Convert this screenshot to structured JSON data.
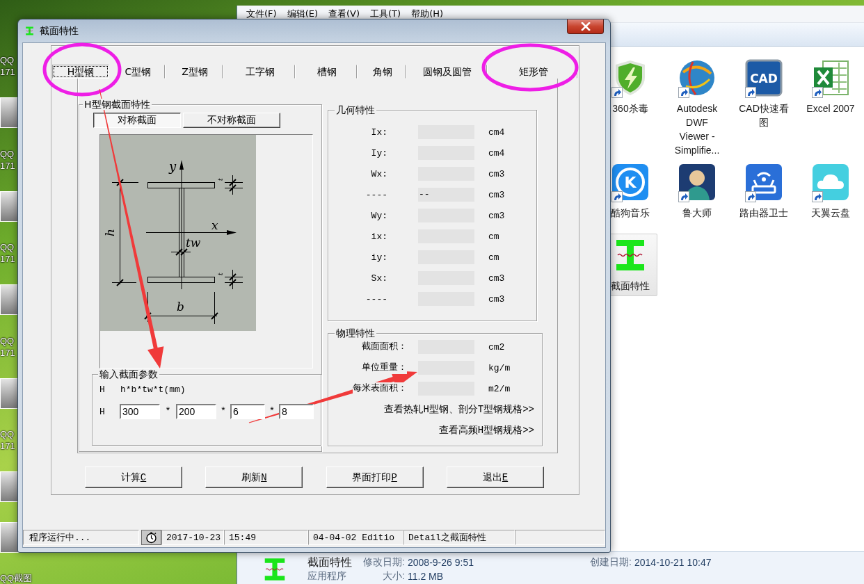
{
  "desktop": {
    "left_icons": [
      {
        "kind": "label",
        "lines": [
          "QQ",
          "171"
        ]
      },
      {
        "kind": "thumb"
      },
      {
        "kind": "label",
        "lines": [
          "QQ",
          "171"
        ]
      },
      {
        "kind": "thumb"
      },
      {
        "kind": "label",
        "lines": [
          "QQ",
          "171"
        ]
      },
      {
        "kind": "thumb"
      },
      {
        "kind": "label",
        "lines": [
          "QQ",
          "171"
        ]
      },
      {
        "kind": "thumb"
      },
      {
        "kind": "label",
        "lines": [
          "QQ",
          "171"
        ]
      },
      {
        "kind": "thumb"
      },
      {
        "kind": "thumb"
      },
      {
        "kind": "label",
        "lines": [
          "QQ截图"
        ]
      }
    ]
  },
  "explorer": {
    "menu": [
      "文件(F)",
      "编辑(E)",
      "查看(V)",
      "工具(T)",
      "帮助(H)"
    ],
    "items": [
      {
        "kind": "shield",
        "label": "360杀毒",
        "selected": false,
        "shortcut": true
      },
      {
        "kind": "globe",
        "label": "Autodesk DWF Viewer - Simplifie...",
        "selected": false,
        "shortcut": true
      },
      {
        "kind": "cad",
        "icon_text": "CAD",
        "label": "CAD快速看图",
        "selected": false,
        "shortcut": true
      },
      {
        "kind": "excel",
        "label": "Excel 2007",
        "selected": false,
        "shortcut": true
      },
      {
        "kind": "music",
        "icon_text": "K",
        "label": "酷狗音乐",
        "selected": false,
        "shortcut": true
      },
      {
        "kind": "character",
        "label": "鲁大师",
        "selected": false,
        "shortcut": true
      },
      {
        "kind": "router",
        "label": "路由器卫士",
        "selected": false,
        "shortcut": true
      },
      {
        "kind": "cloud",
        "label": "天翼云盘",
        "selected": false,
        "shortcut": true
      },
      {
        "kind": "ibeam",
        "label": "截面特性",
        "selected": true,
        "shortcut": false
      }
    ],
    "details": {
      "name": "截面特性",
      "type": "应用程序",
      "fields": [
        {
          "label": "修改日期:",
          "value": "2008-9-26 9:51"
        },
        {
          "label": "创建日期:",
          "value": "2014-10-21 10:47"
        },
        {
          "label": "大小:",
          "value": "11.2 MB"
        }
      ]
    }
  },
  "dialog": {
    "title": "截面特性",
    "tabs": [
      {
        "label": "H型钢",
        "selected": true
      },
      {
        "label": "C型钢",
        "selected": false
      },
      {
        "label": "Z型钢",
        "selected": false
      },
      {
        "label": "工字钢",
        "selected": false
      },
      {
        "label": "槽钢",
        "selected": false
      },
      {
        "label": "角钢",
        "selected": false
      },
      {
        "label": "圆钢及圆管",
        "selected": false
      },
      {
        "label": "矩形管",
        "selected": false
      }
    ],
    "section_group": {
      "title": "H型钢截面特性",
      "types": [
        {
          "label": "对称截面",
          "selected": true
        },
        {
          "label": "不对称截面",
          "selected": false
        }
      ],
      "diagram_labels": [
        {
          "kind": "y_axis",
          "text": "y"
        },
        {
          "kind": "x_axis",
          "text": "x"
        },
        {
          "kind": "web",
          "text": "tw"
        },
        {
          "kind": "height",
          "text": "h"
        },
        {
          "kind": "width",
          "text": "b"
        },
        {
          "kind": "flange_top",
          "text": "t"
        },
        {
          "kind": "flange_bottom",
          "text": "t"
        }
      ]
    },
    "input_group": {
      "title": "输入截面参数",
      "prefix": "H",
      "formula": "h*b*tw*t(mm)",
      "row_prefix": "H",
      "fields": [
        {
          "value": "300"
        },
        {
          "separator": "*",
          "value": "200"
        },
        {
          "separator": "*",
          "value": "6"
        },
        {
          "separator": "*",
          "value": "8"
        }
      ]
    },
    "geometry": {
      "title": "几何特性",
      "rows": [
        {
          "label": "Ix:",
          "unit": "cm4"
        },
        {
          "label": "Iy:",
          "unit": "cm4"
        },
        {
          "label": "Wx:",
          "unit": "cm3"
        },
        {
          "label": "----",
          "value": "--",
          "unit": "cm3"
        },
        {
          "label": "Wy:",
          "unit": "cm3"
        },
        {
          "label": "ix:",
          "unit": "cm"
        },
        {
          "label": "iy:",
          "unit": "cm"
        },
        {
          "label": "Sx:",
          "unit": "cm3"
        },
        {
          "label": "----",
          "unit": "cm3"
        }
      ]
    },
    "physical": {
      "title": "物理特性",
      "rows": [
        {
          "label": "截面面积：",
          "unit": "cm2"
        },
        {
          "label": "单位重量：",
          "unit": "kg/m"
        },
        {
          "label": "每米表面积：",
          "unit": "m2/m"
        }
      ],
      "links": [
        "查看热轧H型钢、剖分T型钢规格>>",
        "查看高频H型钢规格>>"
      ]
    },
    "buttons": [
      {
        "label": "计算",
        "accel": "C"
      },
      {
        "label": "刷新",
        "accel": "N"
      },
      {
        "label": "界面打印",
        "accel": "P"
      },
      {
        "label": "退出",
        "accel": "E"
      }
    ],
    "status_bar": {
      "message": "程序运行中...",
      "date": "2017-10-23",
      "time": "15:49",
      "edition": "04-04-02 Editio",
      "module": "Detail之截面特性"
    }
  }
}
